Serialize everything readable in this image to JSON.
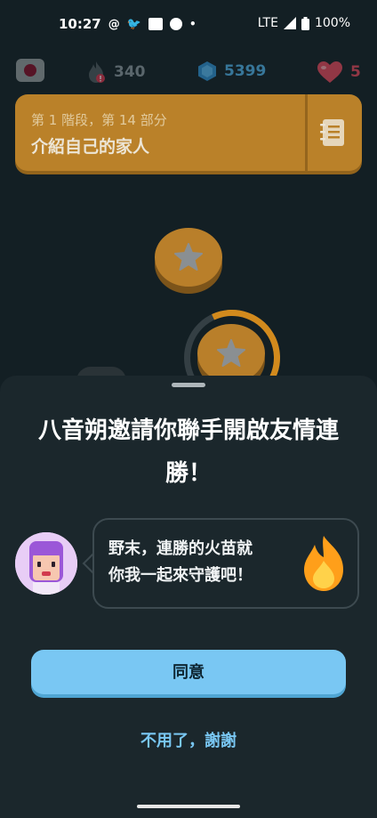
{
  "status_bar": {
    "time": "10:27",
    "network": "LTE",
    "battery": "100%"
  },
  "top_stats": {
    "streak": "340",
    "gems": "5399",
    "hearts": "5"
  },
  "unit": {
    "subtitle": "第 1 階段，第 14 部分",
    "title": "介紹自己的家人"
  },
  "dialog": {
    "title": "八音朔邀請你聯手開啟友情連勝！",
    "message_line1": "野末，連勝的火苗就",
    "message_line2": "你我一起來守護吧！",
    "agree_label": "同意",
    "decline_label": "不用了，謝謝"
  },
  "colors": {
    "accent_blue": "#79c7f3",
    "gold": "#c98a2a",
    "gem_blue": "#4fb0e8",
    "heart_red": "#e5485b"
  }
}
